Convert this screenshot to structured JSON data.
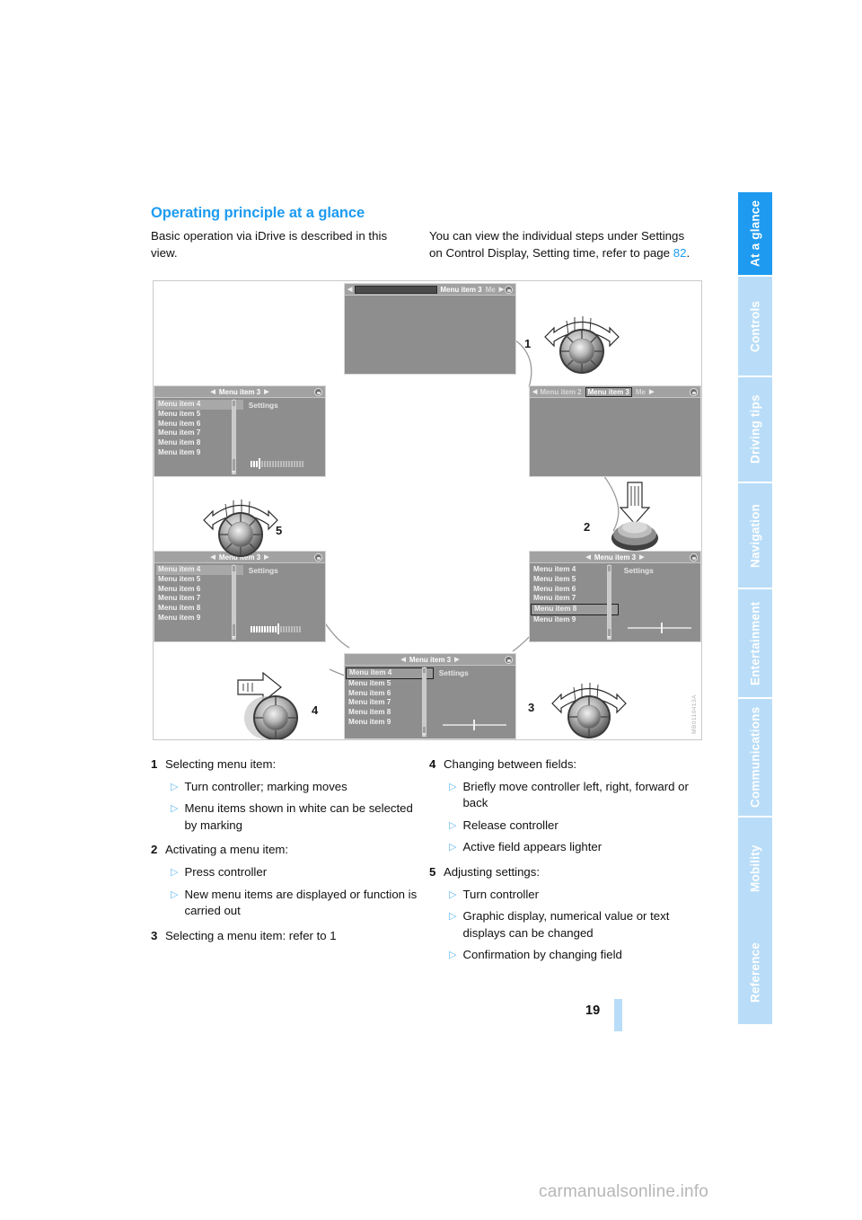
{
  "document": {
    "heading": "Operating principle at a glance",
    "intro_left": "Basic operation via iDrive is described in this view.",
    "intro_right_part1": "You can view the individual steps under Settings on Control Display, Setting time, refer to page ",
    "intro_right_page_link": "82",
    "intro_right_part2": ".",
    "page_number": "19",
    "watermark": "carmanualsonline.info",
    "figure_code": "MB0110413A"
  },
  "sidebar": {
    "tabs": [
      {
        "label": "At a glance",
        "active": true
      },
      {
        "label": "Controls",
        "active": false
      },
      {
        "label": "Driving tips",
        "active": false
      },
      {
        "label": "Navigation",
        "active": false
      },
      {
        "label": "Entertainment",
        "active": false
      },
      {
        "label": "Communications",
        "active": false
      },
      {
        "label": "Mobility",
        "active": false
      },
      {
        "label": "Reference",
        "active": false
      }
    ]
  },
  "figure": {
    "screens": {
      "top_center": {
        "breadcrumb_left_box": "",
        "crumb_a": "Menu item 3",
        "crumb_b": "Me"
      },
      "mid_right": {
        "crumb_a": "Menu item 2",
        "crumb_b": "Menu item 3",
        "crumb_c": "Me"
      },
      "mid_left": {
        "title": "Menu item 3",
        "settings_label": "Settings",
        "menu_items": [
          "Menu item 4",
          "Menu item 5",
          "Menu item 6",
          "Menu item 7",
          "Menu item 8",
          "Menu item 9"
        ],
        "selected": "Menu item 4",
        "selection_style": "flat"
      },
      "bottom_left": {
        "title": "Menu item 3",
        "settings_label": "Settings",
        "menu_items": [
          "Menu item 4",
          "Menu item 5",
          "Menu item 6",
          "Menu item 7",
          "Menu item 8",
          "Menu item 9"
        ],
        "selected": "Menu item 4",
        "selection_style": "flat"
      },
      "bottom_right": {
        "title": "Menu item 3",
        "settings_label": "Settings",
        "menu_items": [
          "Menu item 4",
          "Menu item 5",
          "Menu item 6",
          "Menu item 7",
          "Menu item 8",
          "Menu item 9"
        ],
        "selected": "Menu item 8",
        "selection_style": "box"
      },
      "bottom_center": {
        "title": "Menu item 3",
        "settings_label": "Settings",
        "menu_items": [
          "Menu item 4",
          "Menu item 5",
          "Menu item 6",
          "Menu item 7",
          "Menu item 8",
          "Menu item 9"
        ],
        "selected": "Menu item 4",
        "selection_style": "box"
      }
    },
    "step_markers": [
      "1",
      "2",
      "3",
      "4",
      "5"
    ]
  },
  "instructions": {
    "left": [
      {
        "num": "1",
        "title": "Selecting menu item:",
        "bullets": [
          "Turn controller; marking moves",
          "Menu items shown in white can be selected by marking"
        ]
      },
      {
        "num": "2",
        "title": "Activating a menu item:",
        "bullets": [
          "Press controller",
          "New menu items are displayed or function is carried out"
        ]
      },
      {
        "num": "3",
        "title": "Selecting a menu item: refer to 1",
        "bullets": []
      }
    ],
    "right": [
      {
        "num": "4",
        "title": "Changing between fields:",
        "bullets": [
          "Briefly move controller left, right, forward or back",
          "Release controller",
          "Active field appears lighter"
        ]
      },
      {
        "num": "5",
        "title": "Adjusting settings:",
        "bullets": [
          "Turn controller",
          "Graphic display, numerical value or text displays can be changed",
          "Confirmation by changing field"
        ]
      }
    ]
  },
  "colors": {
    "accent_blue": "#1e9bf0",
    "tab_inactive": "#b9ddf8",
    "bullet_blue": "#63b8ef"
  }
}
